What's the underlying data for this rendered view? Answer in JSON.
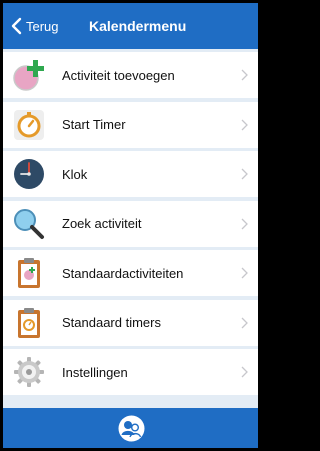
{
  "navbar": {
    "back_label": "Terug",
    "title": "Kalendermenu"
  },
  "menu": {
    "items": [
      {
        "label": "Activiteit toevoegen",
        "icon": "add-activity-icon"
      },
      {
        "label": "Start Timer",
        "icon": "timer-icon"
      },
      {
        "label": "Klok",
        "icon": "clock-icon"
      },
      {
        "label": "Zoek activiteit",
        "icon": "search-icon"
      },
      {
        "label": "Standaardactiviteiten",
        "icon": "standard-activities-icon"
      },
      {
        "label": "Standaard timers",
        "icon": "standard-timers-icon"
      },
      {
        "label": "Instellingen",
        "icon": "settings-gear-icon"
      }
    ]
  },
  "bottombar": {
    "icon": "users-icon"
  },
  "colors": {
    "primary": "#1f6dc4",
    "background": "#e3ecf5",
    "row": "#ffffff",
    "chevron": "#c7c7cc"
  }
}
